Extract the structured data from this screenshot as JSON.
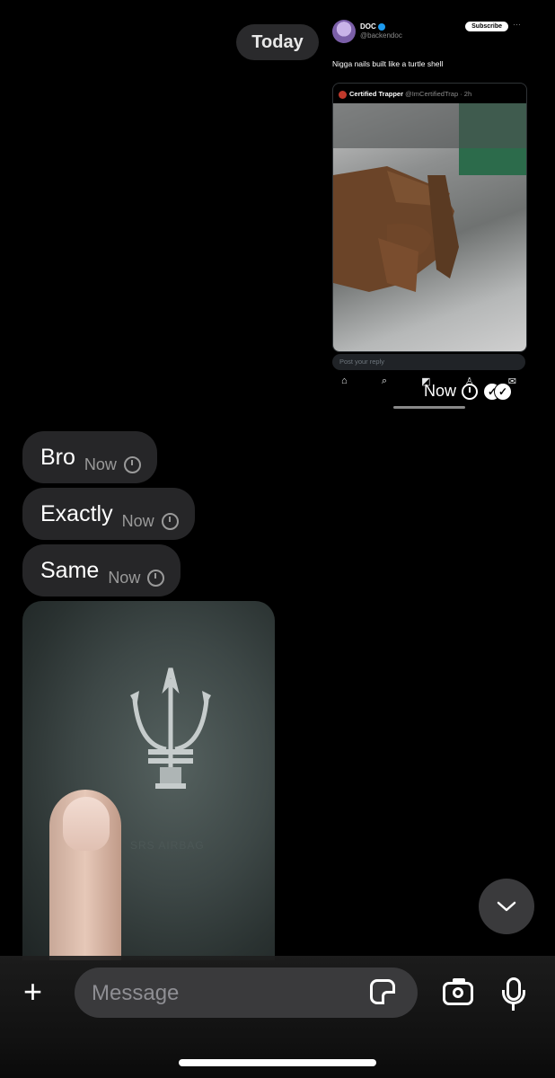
{
  "conversation": {
    "date_divider": "Today"
  },
  "shared_screenshot": {
    "author_name": "DOC",
    "author_handle": "@backendoc",
    "subscribe_label": "Subscribe",
    "more_glyph": "···",
    "tweet_text": "Nigga nails built like a turtle shell",
    "quote_author": "Certified Trapper",
    "quote_handle": "@ImCertifiedTrap · 2h",
    "reply_placeholder": "Post your reply",
    "tab_icons": [
      "home-icon",
      "search-icon",
      "grok-icon",
      "people-icon",
      "mail-icon"
    ],
    "meta_time": "Now"
  },
  "messages": [
    {
      "text": "Bro",
      "time": "Now"
    },
    {
      "text": "Exactly",
      "time": "Now"
    },
    {
      "text": "Same",
      "time": "Now"
    }
  ],
  "photo": {
    "emboss_text": "SRS AIRBAG"
  },
  "composer": {
    "placeholder": "Message"
  },
  "colors": {
    "bubble": "#262628",
    "background": "#000000",
    "field": "#3a3a3c",
    "verified": "#1d9bf0"
  }
}
